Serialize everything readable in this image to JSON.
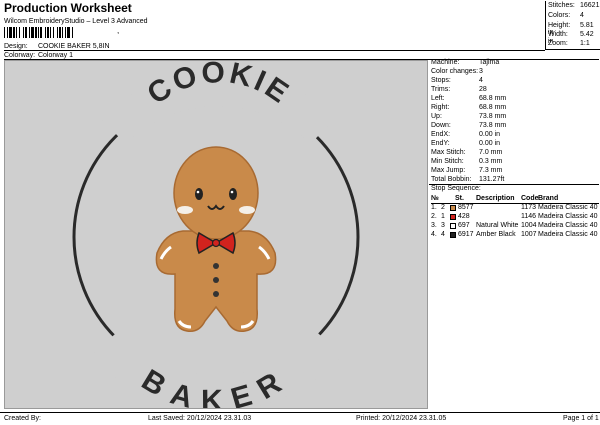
{
  "header": {
    "title": "Production Worksheet",
    "subtitle": "Wilcom EmbroideryStudio – Level 3 Advanced",
    "barcode_mark": ",",
    "design_label": "Design:",
    "design_value": "COOKIE BAKER 5,8IN",
    "colorway_label": "Colorway:",
    "colorway_value": "Colorway 1"
  },
  "stats": [
    {
      "label": "Stitches:",
      "value": "16621"
    },
    {
      "label": "Colors:",
      "value": "4"
    },
    {
      "label": "Height:",
      "value": "5.81 in"
    },
    {
      "label": "Width:",
      "value": "5.42 in"
    },
    {
      "label": "Zoom:",
      "value": "1:1"
    }
  ],
  "design": {
    "top_text": "COOKIE",
    "bottom_text": "BAKER"
  },
  "info": [
    {
      "label": "Machine:",
      "value": "Tajima"
    },
    {
      "label": "Color changes:",
      "value": "3"
    },
    {
      "label": "Stops:",
      "value": "4"
    },
    {
      "label": "Trims:",
      "value": "28"
    },
    {
      "label": "Left:",
      "value": "68.8 mm"
    },
    {
      "label": "Right:",
      "value": "68.8 mm"
    },
    {
      "label": "Up:",
      "value": "73.8 mm"
    },
    {
      "label": "Down:",
      "value": "73.8 mm"
    },
    {
      "label": "EndX:",
      "value": "0.00 in"
    },
    {
      "label": "EndY:",
      "value": "0.00 in"
    },
    {
      "label": "Max Stitch:",
      "value": "7.0 mm"
    },
    {
      "label": "Min Stitch:",
      "value": "0.3 mm"
    },
    {
      "label": "Max Jump:",
      "value": "7.3 mm"
    },
    {
      "label": "Total Bobbin:",
      "value": "131.27ft"
    }
  ],
  "stop_sequence": {
    "title": "Stop Sequence:",
    "headers": {
      "num": "№",
      "st": "St.",
      "desc": "Description",
      "code": "Code",
      "brand": "Brand"
    },
    "rows": [
      {
        "idx": "1.",
        "n": "2",
        "color": "#c98a4a",
        "st": "8577",
        "desc": "",
        "code": "1173",
        "brand": "Madeira Classic 40"
      },
      {
        "idx": "2.",
        "n": "1",
        "color": "#d2231e",
        "st": "428",
        "desc": "",
        "code": "1146",
        "brand": "Madeira Classic 40"
      },
      {
        "idx": "3.",
        "n": "3",
        "color": "#ffffff",
        "st": "697",
        "desc": "Natural White",
        "code": "1004",
        "brand": "Madeira Classic 40"
      },
      {
        "idx": "4.",
        "n": "4",
        "color": "#222222",
        "st": "6917",
        "desc": "Amber Black",
        "code": "1007",
        "brand": "Madeira Classic 40"
      }
    ]
  },
  "footer": {
    "created_by": "Created By:",
    "last_saved": "Last Saved: 20/12/2024 23.31.03",
    "printed": "Printed: 20/12/2024 23.31.05",
    "page": "Page 1 of 1"
  }
}
